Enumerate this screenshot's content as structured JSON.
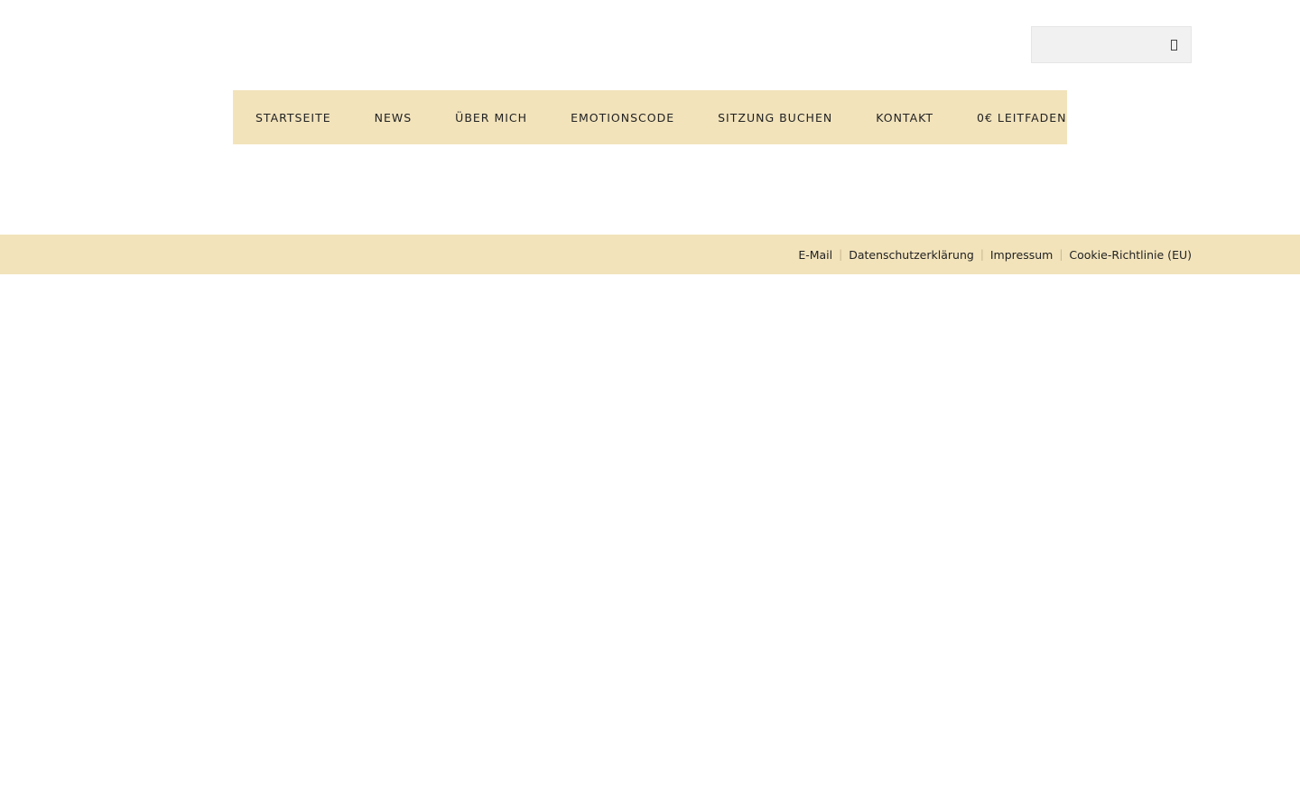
{
  "search": {
    "placeholder": "",
    "value": "",
    "icon": "search-icon"
  },
  "nav": {
    "items": [
      {
        "label": "STARTSEITE"
      },
      {
        "label": "NEWS"
      },
      {
        "label": "ÜBER MICH"
      },
      {
        "label": "EMOTIONSCODE"
      },
      {
        "label": "SITZUNG BUCHEN"
      },
      {
        "label": "KONTAKT"
      },
      {
        "label": "0€ LEITFADEN"
      }
    ]
  },
  "footer": {
    "links": [
      {
        "label": "E-Mail"
      },
      {
        "label": "Datenschutzerklärung"
      },
      {
        "label": "Impressum"
      },
      {
        "label": "Cookie-Richtlinie (EU)"
      }
    ]
  },
  "colors": {
    "accent_background": "#f2e3bb",
    "search_background": "#f1f1f1",
    "text": "#222222"
  }
}
